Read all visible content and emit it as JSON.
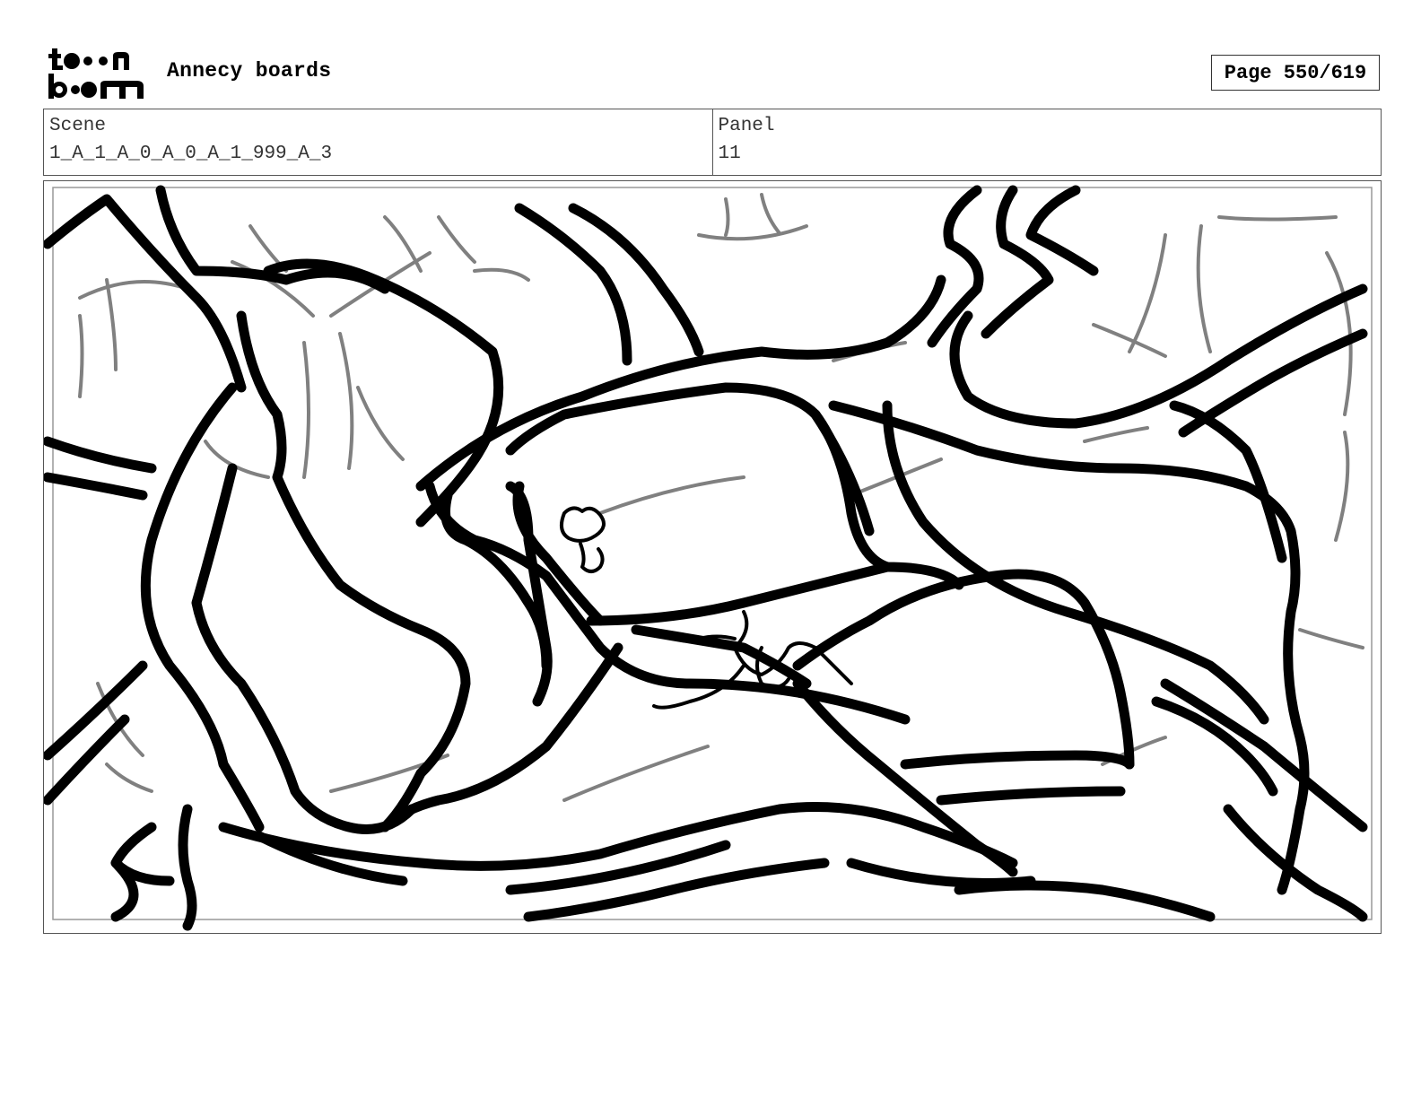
{
  "header": {
    "logo_text_top": "toon",
    "logo_text_bottom": "boom",
    "title": "Annecy boards",
    "page_label": "Page 550/619"
  },
  "info": {
    "scene_label": "Scene",
    "scene_value": "1_A_1_A_0_A_0_A_1_999_A_3",
    "panel_label": "Panel",
    "panel_value": "11"
  },
  "drawing": {
    "description_icon": "storyboard-sketch",
    "stroke_color": "#000000",
    "background_stroke_color": "#808080"
  }
}
